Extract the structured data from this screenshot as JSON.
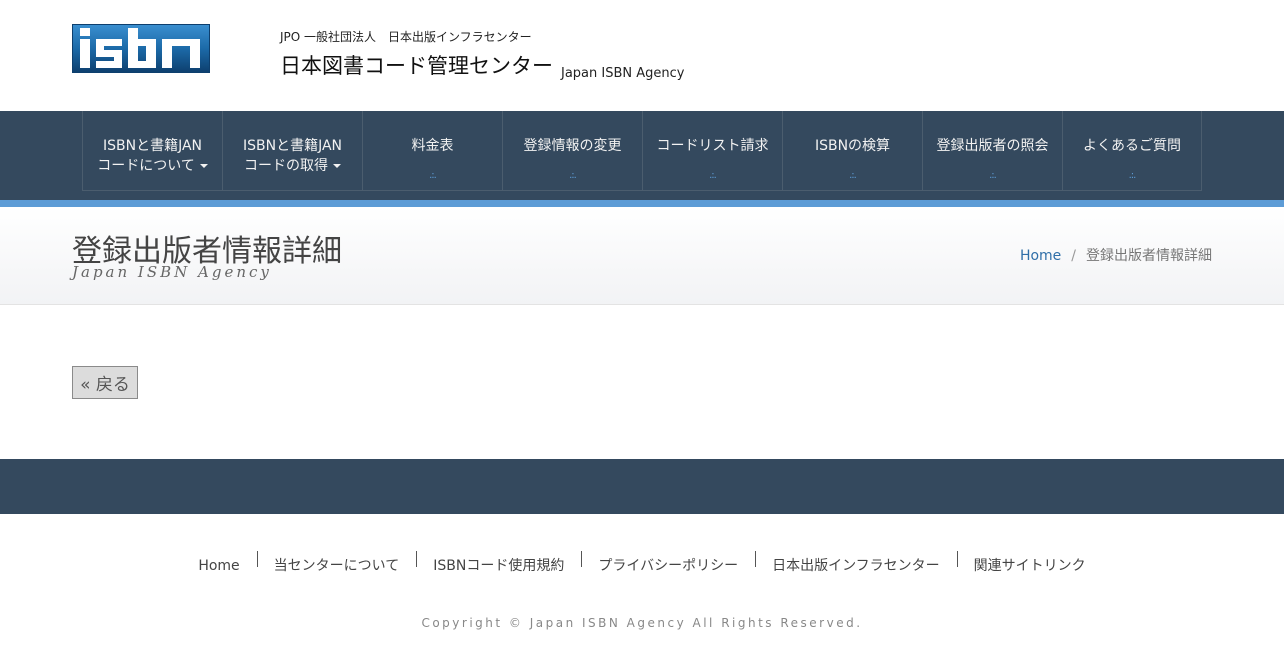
{
  "header": {
    "logo_text": "isbn",
    "org_subtitle": "JPO 一般社団法人　日本出版インフラセンター",
    "site_title": "日本図書コード管理センター",
    "site_title_en": "Japan ISBN Agency"
  },
  "nav": {
    "items": [
      {
        "line1": "ISBNと書籍JAN",
        "line2": "コードについて",
        "dropdown": true
      },
      {
        "line1": "ISBNと書籍JAN",
        "line2": "コードの取得",
        "dropdown": true
      },
      {
        "line1": "料金表",
        "line2": "",
        "dropdown": false
      },
      {
        "line1": "登録情報の変更",
        "line2": "",
        "dropdown": false
      },
      {
        "line1": "コードリスト請求",
        "line2": "",
        "dropdown": false
      },
      {
        "line1": "ISBNの検算",
        "line2": "",
        "dropdown": false
      },
      {
        "line1": "登録出版者の照会",
        "line2": "",
        "dropdown": false
      },
      {
        "line1": "よくあるご質問",
        "line2": "",
        "dropdown": false
      }
    ],
    "accent_color": "#5d9cd6",
    "bg_color": "#34495e"
  },
  "page": {
    "title": "登録出版者情報詳細",
    "subtitle": "Japan ISBN Agency",
    "breadcrumb": {
      "home": "Home",
      "separator": "/",
      "current": "登録出版者情報詳細"
    },
    "back_label": "« 戻る"
  },
  "footer": {
    "links": [
      "Home",
      "当センターについて",
      "ISBNコード使用規約",
      "プライバシーポリシー",
      "日本出版インフラセンター",
      "関連サイトリンク"
    ],
    "copyright": "Copyright © Japan ISBN Agency All Rights Reserved."
  }
}
